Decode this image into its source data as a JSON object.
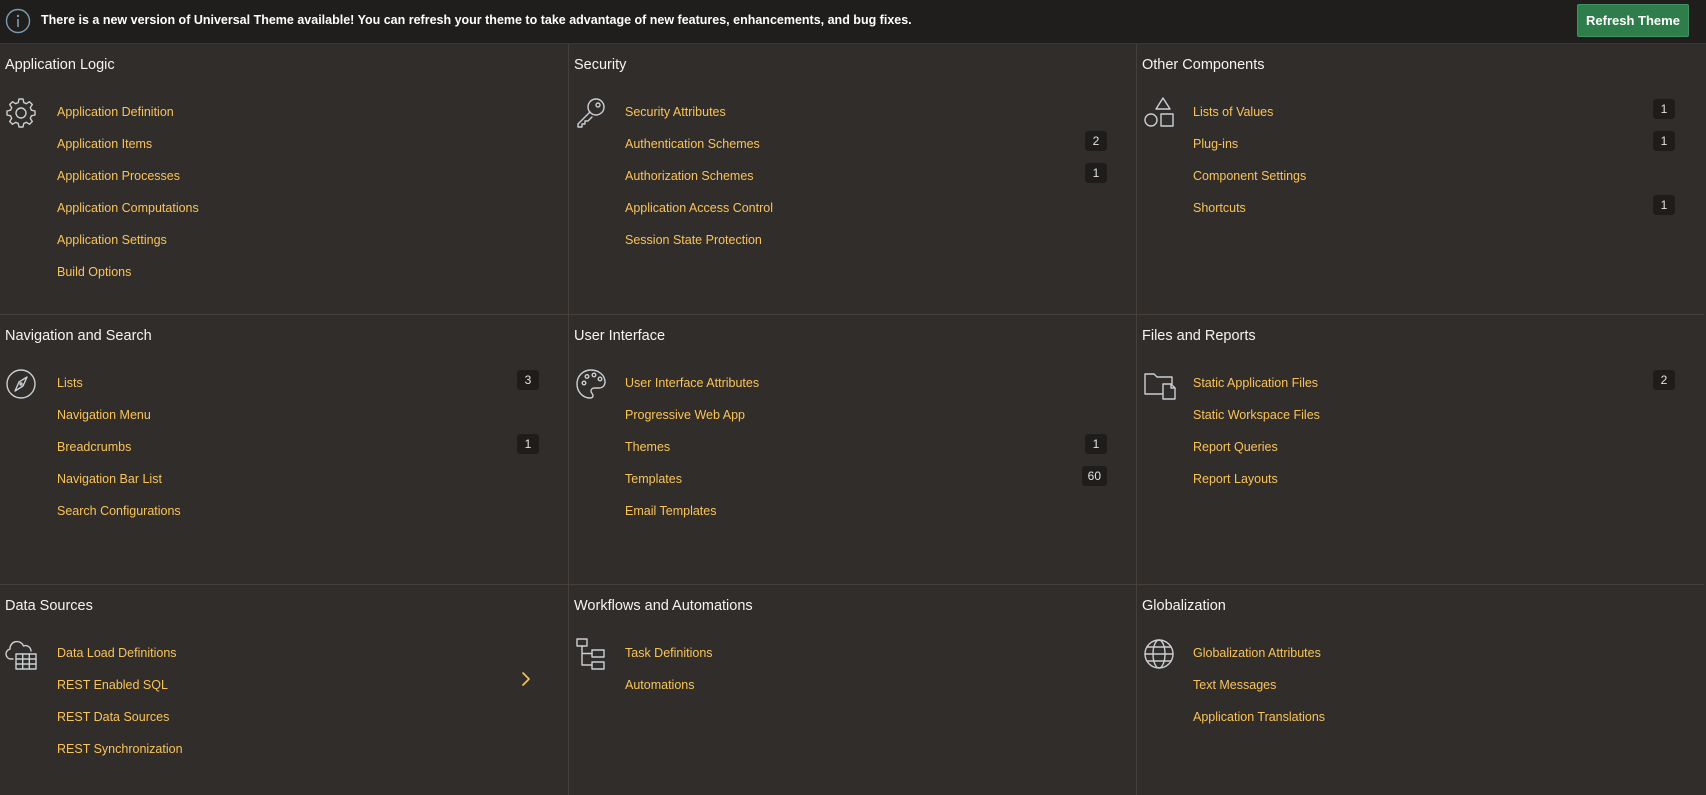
{
  "banner": {
    "message": "There is a new version of Universal Theme available! You can refresh your theme to take advantage of new features, enhancements, and bug fixes.",
    "button_label": "Refresh Theme",
    "icon": "info-icon"
  },
  "colors": {
    "background": "#312d2a",
    "banner_bg": "#201e1c",
    "link": "#f9c35a",
    "button": "#2f7d4b",
    "badge_bg": "#1f1d1b"
  },
  "panels": {
    "application_logic": {
      "title": "Application Logic",
      "icon": "gear-icon",
      "items": [
        {
          "label": "Application Definition"
        },
        {
          "label": "Application Items"
        },
        {
          "label": "Application Processes"
        },
        {
          "label": "Application Computations"
        },
        {
          "label": "Application Settings"
        },
        {
          "label": "Build Options"
        }
      ]
    },
    "security": {
      "title": "Security",
      "icon": "key-icon",
      "items": [
        {
          "label": "Security Attributes"
        },
        {
          "label": "Authentication Schemes",
          "count": "2"
        },
        {
          "label": "Authorization Schemes",
          "count": "1"
        },
        {
          "label": "Application Access Control"
        },
        {
          "label": "Session State Protection"
        }
      ]
    },
    "other_components": {
      "title": "Other Components",
      "icon": "shapes-icon",
      "items": [
        {
          "label": "Lists of Values",
          "count": "1"
        },
        {
          "label": "Plug-ins",
          "count": "1"
        },
        {
          "label": "Component Settings"
        },
        {
          "label": "Shortcuts",
          "count": "1"
        }
      ]
    },
    "navigation_search": {
      "title": "Navigation and Search",
      "icon": "compass-icon",
      "items": [
        {
          "label": "Lists",
          "count": "3"
        },
        {
          "label": "Navigation Menu"
        },
        {
          "label": "Breadcrumbs",
          "count": "1"
        },
        {
          "label": "Navigation Bar List"
        },
        {
          "label": "Search Configurations"
        }
      ]
    },
    "user_interface": {
      "title": "User Interface",
      "icon": "palette-icon",
      "items": [
        {
          "label": "User Interface Attributes"
        },
        {
          "label": "Progressive Web App"
        },
        {
          "label": "Themes",
          "count": "1"
        },
        {
          "label": "Templates",
          "count": "60"
        },
        {
          "label": "Email Templates"
        }
      ]
    },
    "files_reports": {
      "title": "Files and Reports",
      "icon": "folder-file-icon",
      "items": [
        {
          "label": "Static Application Files",
          "count": "2"
        },
        {
          "label": "Static Workspace Files"
        },
        {
          "label": "Report Queries"
        },
        {
          "label": "Report Layouts"
        }
      ]
    },
    "data_sources": {
      "title": "Data Sources",
      "icon": "cloud-table-icon",
      "items": [
        {
          "label": "Data Load Definitions"
        },
        {
          "label": "REST Enabled SQL",
          "chevron": "chevron-right-icon"
        },
        {
          "label": "REST Data Sources"
        },
        {
          "label": "REST Synchronization"
        }
      ]
    },
    "workflows_automations": {
      "title": "Workflows and Automations",
      "icon": "workflow-icon",
      "items": [
        {
          "label": "Task Definitions"
        },
        {
          "label": "Automations"
        }
      ]
    },
    "globalization": {
      "title": "Globalization",
      "icon": "globe-icon",
      "items": [
        {
          "label": "Globalization Attributes"
        },
        {
          "label": "Text Messages"
        },
        {
          "label": "Application Translations"
        }
      ]
    }
  }
}
